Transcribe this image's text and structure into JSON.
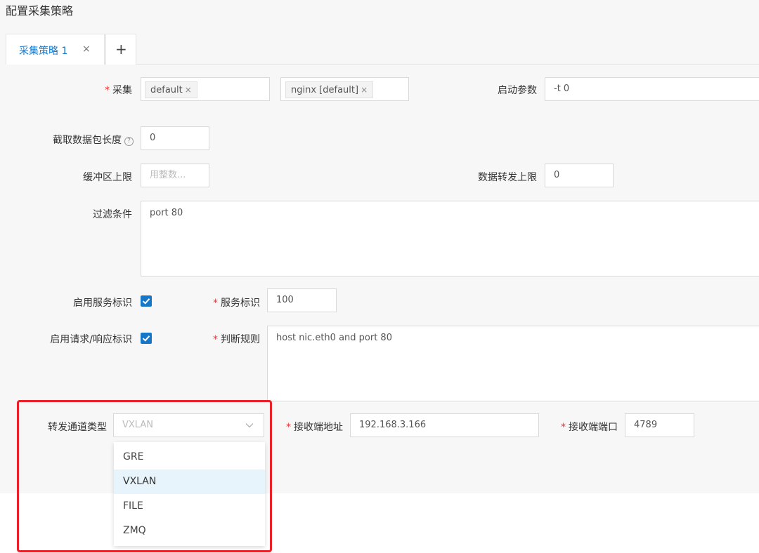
{
  "page": {
    "title": "配置采集策略"
  },
  "tabs": [
    {
      "label": "采集策略 1",
      "close": "×"
    }
  ],
  "tab_add": "+",
  "form": {
    "collect": {
      "label": "采集",
      "tags_a": [
        {
          "text": "default",
          "x": "×"
        }
      ],
      "tags_b": [
        {
          "text": "nginx [default]",
          "x": "×"
        }
      ]
    },
    "start_params": {
      "label": "启动参数",
      "value": "-t 0"
    },
    "snaplen": {
      "label": "截取数据包长度",
      "help": "?",
      "value": "0"
    },
    "buffer": {
      "label": "缓冲区上限",
      "placeholder": "用整数..."
    },
    "forward_limit": {
      "label": "数据转发上限",
      "value": "0"
    },
    "filter": {
      "label": "过滤条件",
      "value": "port 80"
    },
    "service_flag": {
      "label": "启用服务标识",
      "checked": true
    },
    "service_id": {
      "label": "服务标识",
      "value": "100"
    },
    "reqresp_flag": {
      "label": "启用请求/响应标识",
      "checked": true
    },
    "rule": {
      "label": "判断规则",
      "value": "host nic.eth0 and port 80"
    },
    "channel_type": {
      "label": "转发通道类型",
      "value": "VXLAN",
      "options": [
        "GRE",
        "VXLAN",
        "FILE",
        "ZMQ"
      ],
      "selected_index": 1
    },
    "recv_addr": {
      "label": "接收端地址",
      "value": "192.168.3.166"
    },
    "recv_port": {
      "label": "接收端端口",
      "value": "4789"
    }
  },
  "colors": {
    "accent": "#1677c8",
    "required": "#e4393c",
    "highlight_box": "#e8212b",
    "option_selected_bg": "#e8f4fb"
  },
  "icons": [
    "close-icon",
    "plus-icon",
    "help-icon",
    "check-icon",
    "chevron-down-icon"
  ]
}
